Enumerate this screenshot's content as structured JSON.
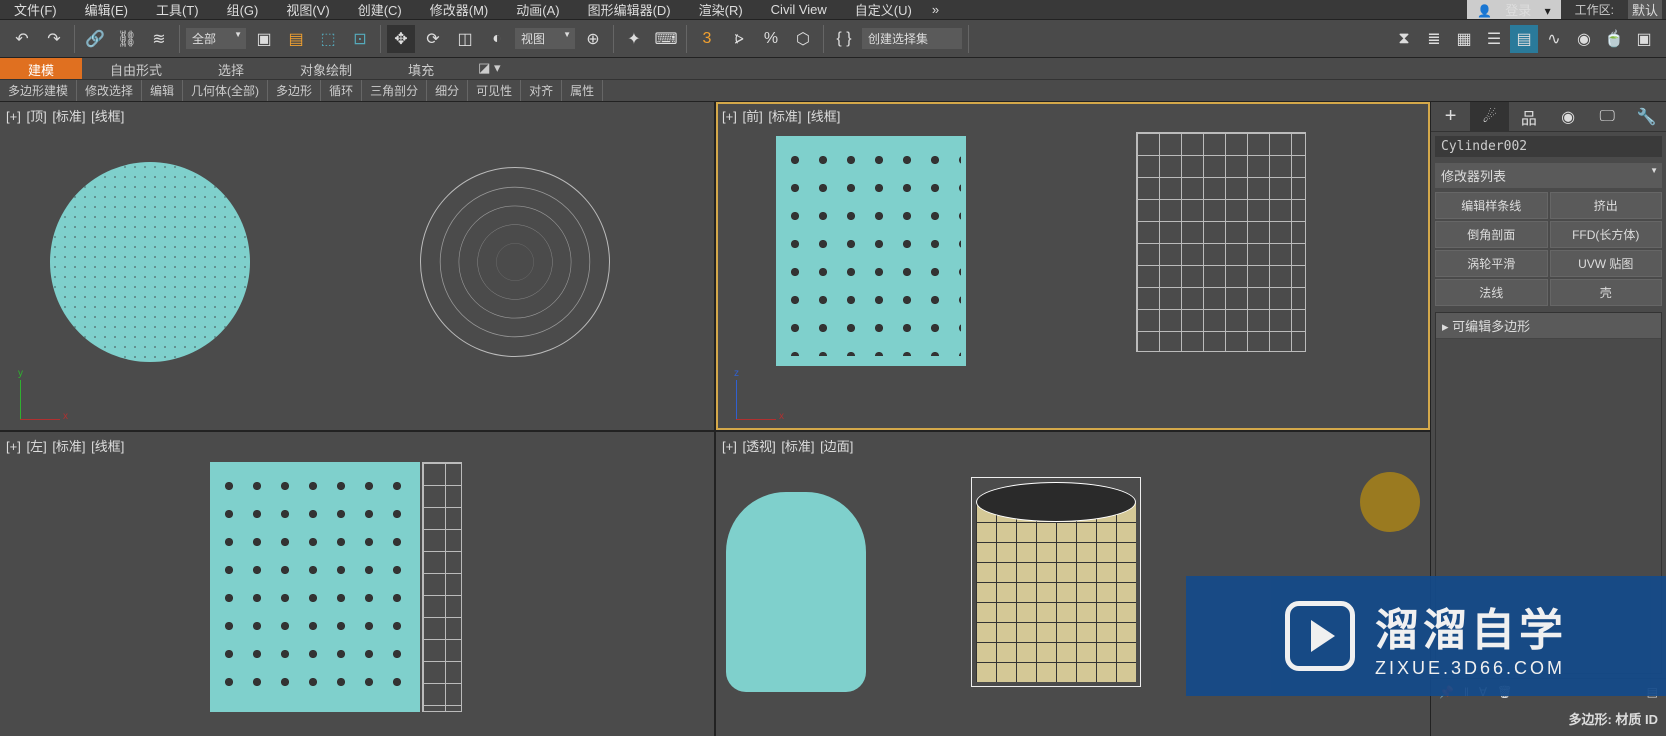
{
  "menus": {
    "file": "文件(F)",
    "edit": "编辑(E)",
    "tools": "工具(T)",
    "group": "组(G)",
    "views": "视图(V)",
    "create": "创建(C)",
    "modifiers": "修改器(M)",
    "animation": "动画(A)",
    "grapheditors": "图形编辑器(D)",
    "rendering": "渲染(R)",
    "civilview": "Civil View",
    "customize": "自定义(U)",
    "login": "登录",
    "workspace_label": "工作区:",
    "workspace_value": "默认"
  },
  "toolbar": {
    "all": "全部",
    "view": "视图",
    "selset": "创建选择集"
  },
  "ribbon": {
    "tabs": {
      "modeling": "建模",
      "freeform": "自由形式",
      "selection": "选择",
      "objpaint": "对象绘制",
      "populate": "填充"
    },
    "sub": [
      "多边形建模",
      "修改选择",
      "编辑",
      "几何体(全部)",
      "多边形",
      "循环",
      "三角剖分",
      "细分",
      "可见性",
      "对齐",
      "属性"
    ]
  },
  "viewports": {
    "top": {
      "plus": "[+]",
      "name": "[顶]",
      "shade": "[标准]",
      "mode": "[线框]"
    },
    "front": {
      "plus": "[+]",
      "name": "[前]",
      "shade": "[标准]",
      "mode": "[线框]"
    },
    "left": {
      "plus": "[+]",
      "name": "[左]",
      "shade": "[标准]",
      "mode": "[线框]"
    },
    "persp": {
      "plus": "[+]",
      "name": "[透视]",
      "shade": "[标准]",
      "mode": "[边面]"
    }
  },
  "panel": {
    "objname": "Cylinder002",
    "modlist": "修改器列表",
    "buttons": {
      "editspline": "编辑样条线",
      "extrude": "挤出",
      "bevelprofile": "倒角剖面",
      "ffdbox": "FFD(长方体)",
      "turbosmooth": "涡轮平滑",
      "uvwmap": "UVW 贴图",
      "normal": "法线",
      "shell": "壳"
    },
    "stackitem": "可编辑多边形",
    "rollout": "多边形: 材质 ID"
  },
  "watermark": {
    "title": "溜溜自学",
    "url": "ZIXUE.3D66.COM"
  }
}
